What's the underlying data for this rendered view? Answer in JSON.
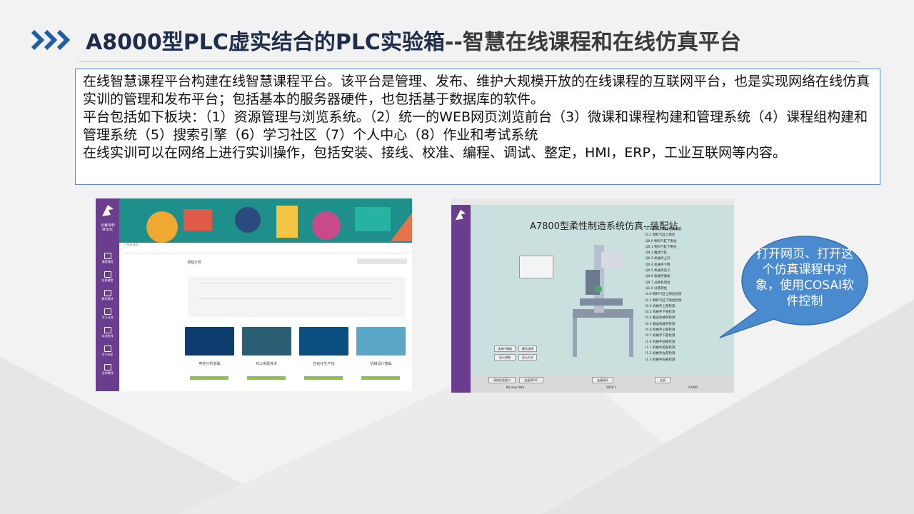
{
  "slide": {
    "title_main": "A8000型PLC虚实结合的PLC实验箱",
    "title_sub": "--智慧在线课程和在线仿真平台",
    "description": [
      "在线智慧课程平台构建在线智慧课程平台。该平台是管理、发布、维护大规模开放的在线课程的互联网平台，也是实现网络在线仿真实训的管理和发布平台；包括基本的服务器硬件，也包括基于数据库的软件。",
      "平台包括如下板块：（1）资源管理与浏览系统。（2）统一的WEB网页浏览前台（3）微课和课程构建和管理系统（4）课程组构建和管理系统（5）搜索引擎（6）学习社区（7）个人中心（8）作业和考试系统",
      "在线实训可以在网络上进行实训操作，包括安装、接线、校准、编程、调试、整定，HMI，ERP，工业互联网等内容。"
    ],
    "callout": "打开网页、打开这个仿真课程中对象，使用COSAI软件控制",
    "colors": {
      "accent": "#1f5fa6",
      "callout": "#4a8bd0",
      "sidebar": "#6a3d8f"
    }
  },
  "shot1": {
    "logo_text": "云睿百科MOOC",
    "nav": [
      "课程课程",
      "在线课堂",
      "教学素材",
      "学习计划",
      "实训在线",
      "学习社区",
      "合作教师"
    ],
    "search_placeholder": "搜索课程",
    "section": "课程分类",
    "cards": [
      "电控分析基础",
      "PLC实践技术",
      "自动化生产线",
      "机械设计基础"
    ]
  },
  "shot2": {
    "window_title": "A7800型柔性制造系统仿真--装配站",
    "buttons": [
      "选单片模拟",
      "模式选择",
      "显示控制",
      "显示方式"
    ],
    "io_lines": [
      "I0.0 配料、物块选择分配",
      "I0.1 物料气缸上限位",
      "Q0.0 物料气缸下限位",
      "Q0.1 物料气缸下限位",
      "Q0.2 推动气缸",
      "Q0.3 机械手上升",
      "Q0.4 机械手下降",
      "Q0.5 机械手夹爪",
      "Q0.6 机械手放松",
      "Q0.7 分拣机到位",
      "Q1.0 分拣到位",
      "I0.0 物料气缸上限位检测",
      "I0.1 物料气缸下限位检测",
      "I0.2 机械手上限检测",
      "I0.3 机械手下限检测",
      "I0.4 搬运机械手检测",
      "I0.5 搬运机械手检测",
      "I0.6 机械手上部检测",
      "I0.7 机械手下部检测",
      "I1.0 机械手前部检测",
      "I1.1 机械手后部检测",
      "I1.2 机械手左部检测",
      "I1.3 机械手右部检测"
    ],
    "bottom": [
      "清除信息窗口",
      "连接到PLC",
      "连接模式",
      "全部",
      "No new data",
      "2830.1",
      "A7800"
    ]
  }
}
